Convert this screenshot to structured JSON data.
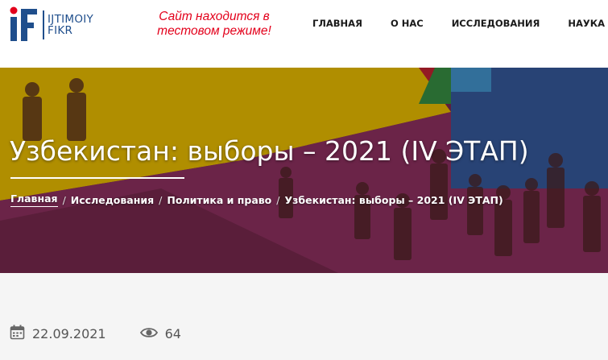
{
  "logo": {
    "line1": "IJTIMOIY",
    "line2": "FIKR"
  },
  "notice": "Сайт находится в тестовом режиме!",
  "nav": {
    "items": [
      "ГЛАВНАЯ",
      "О НАС",
      "ИССЛЕДОВАНИЯ",
      "НАУКА И С"
    ]
  },
  "hero": {
    "title": "Узбекистан: выборы – 2021 (IV ЭТАП)",
    "breadcrumb": {
      "home": "Главная",
      "research": "Исследования",
      "category": "Политика и право",
      "current": "Узбекистан: выборы – 2021 (IV ЭТАП)"
    },
    "separator": "/"
  },
  "meta": {
    "date": "22.09.2021",
    "views": "64",
    "icons": [
      "calendar-icon",
      "eye-icon"
    ]
  },
  "colors": {
    "brand_blue": "#1f4e8c",
    "brand_red": "#e3001b",
    "hero_yellow": "#c9a200",
    "hero_magenta": "#7a2a52",
    "hero_blue": "#2e4d86"
  }
}
